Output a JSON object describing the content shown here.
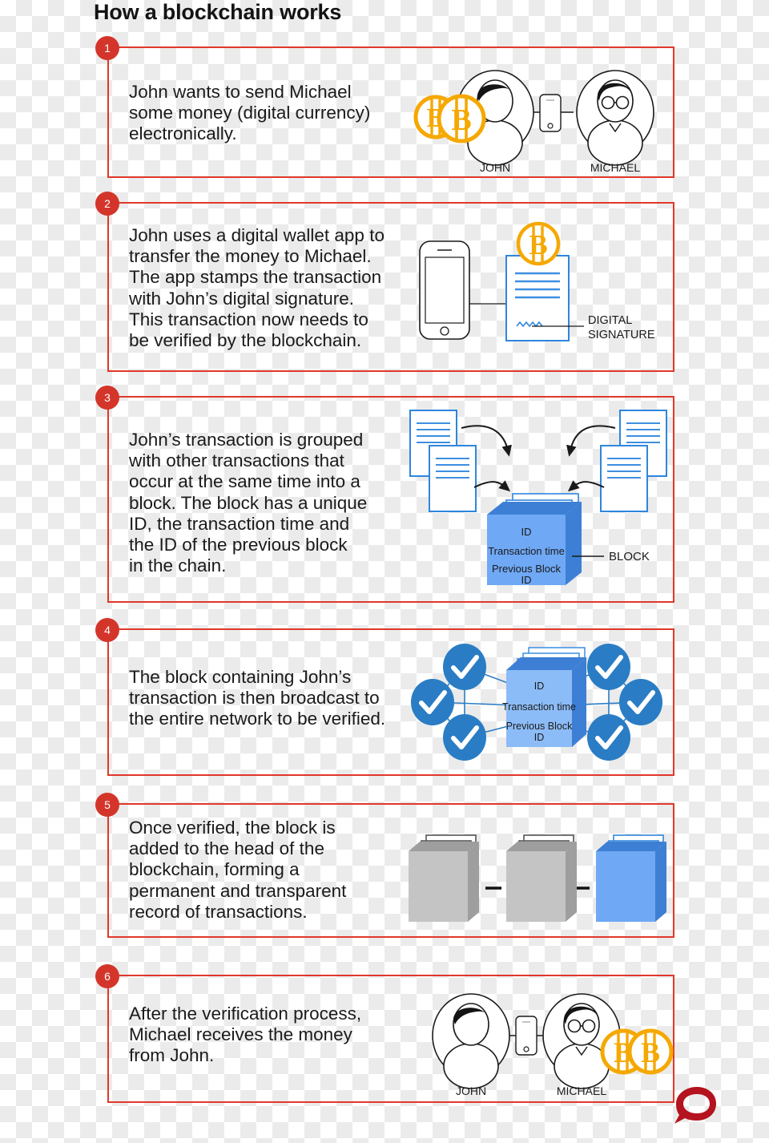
{
  "title": "How a blockchain works",
  "brand": {
    "red": "#e0382a",
    "badge_red": "#d4352a",
    "bitcoin_gold": "#f5a800",
    "block_blue": "#6fa8f5",
    "block_blue_dark": "#3d7fd4",
    "check_blue": "#2a7dc4",
    "doc_blue": "#2e86de",
    "block_gray": "#c4c4c4",
    "logo_red": "#b4131f"
  },
  "steps": [
    {
      "number": "1",
      "text": "John wants to send Michael\nsome money (digital currency)\nelectronically.",
      "labels": {
        "john": "JOHN",
        "michael": "MICHAEL"
      }
    },
    {
      "number": "2",
      "text": "John uses a digital wallet app to\ntransfer the money to Michael.\nThe app stamps the transaction\nwith John’s digital signature.\nThis transaction now needs to\nbe verified by the blockchain.",
      "labels": {
        "digital_signature_line1": "DIGITAL",
        "digital_signature_line2": "SIGNATURE"
      }
    },
    {
      "number": "3",
      "text": "John’s transaction is grouped\nwith other transactions that\noccur at the same time into a\nblock. The block has a unique\nID, the transaction time and\nthe ID of the previous block\nin the chain.",
      "labels": {
        "block_id": "ID",
        "block_time": "Transaction time",
        "block_prev_line1": "Previous Block",
        "block_prev_line2": "ID",
        "block_callout": "BLOCK"
      }
    },
    {
      "number": "4",
      "text": "The block containing John’s\ntransaction is then broadcast to\nthe entire network to be verified.",
      "labels": {
        "block_id": "ID",
        "block_time": "Transaction time",
        "block_prev_line1": "Previous Block",
        "block_prev_line2": "ID"
      }
    },
    {
      "number": "5",
      "text": "Once verified, the block is\nadded to the head of the\nblockchain, forming a\npermanent and transparent\nrecord of transactions."
    },
    {
      "number": "6",
      "text": "After the verification process,\nMichael receives the money\nfrom John.",
      "labels": {
        "john": "JOHN",
        "michael": "MICHAEL"
      }
    }
  ],
  "logo": {
    "name": "the-conversation-logo"
  }
}
